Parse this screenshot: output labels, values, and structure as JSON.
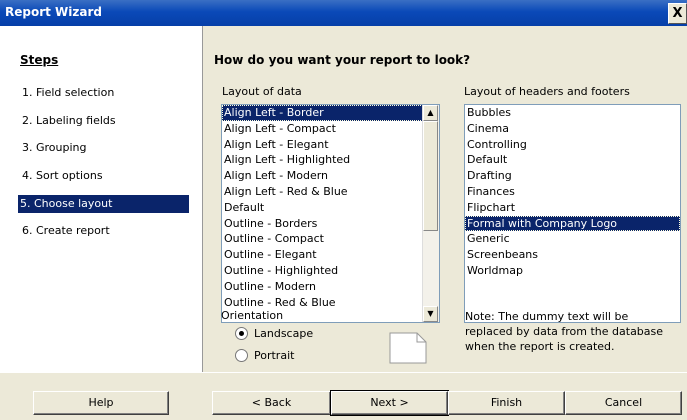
{
  "window": {
    "title": "Report Wizard",
    "close_label": "X"
  },
  "steps": {
    "heading": "Steps",
    "items": [
      {
        "label": "1.  Field selection",
        "selected": false
      },
      {
        "label": "2.  Labeling fields",
        "selected": false
      },
      {
        "label": "3.  Grouping",
        "selected": false
      },
      {
        "label": "4.  Sort options",
        "selected": false
      },
      {
        "label": "5.  Choose layout",
        "selected": true
      },
      {
        "label": "6.  Create report",
        "selected": false
      }
    ]
  },
  "main": {
    "question": "How do you want your report to look?",
    "layout_data": {
      "label": "Layout of data",
      "items": [
        "Align Left - Border",
        "Align Left - Compact",
        "Align Left - Elegant",
        "Align Left - Highlighted",
        "Align Left - Modern",
        "Align Left - Red & Blue",
        "Default",
        "Outline - Borders",
        "Outline - Compact",
        "Outline - Elegant",
        "Outline - Highlighted",
        "Outline - Modern",
        "Outline - Red & Blue"
      ],
      "selected": "Align Left - Border"
    },
    "layout_headers": {
      "label": "Layout of headers and footers",
      "items": [
        "Bubbles",
        "Cinema",
        "Controlling",
        "Default",
        "Drafting",
        "Finances",
        "Flipchart",
        "Formal with Company Logo",
        "Generic",
        "Screenbeans",
        "Worldmap"
      ],
      "selected": "Formal with Company Logo"
    },
    "orientation": {
      "label": "Orientation",
      "landscape": "Landscape",
      "portrait": "Portrait",
      "selected": "Landscape"
    },
    "note": "Note: The dummy text will be replaced by data from the database when the report is created."
  },
  "buttons": {
    "help": "Help",
    "back": "< Back",
    "next": "Next >",
    "finish": "Finish",
    "cancel": "Cancel"
  },
  "colors": {
    "titlebar": "#0a49b8",
    "selection": "#0a246a",
    "background": "#ece9d8"
  }
}
